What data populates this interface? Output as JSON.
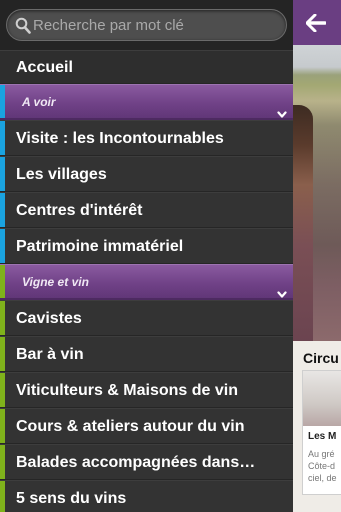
{
  "search": {
    "placeholder": "Recherche par mot clé"
  },
  "menu": {
    "home": "Accueil",
    "section_a_voir": "A voir",
    "a_voir_items": [
      "Visite : les Incontournables",
      "Les villages",
      "Centres d'intérêt",
      "Patrimoine  immatériel"
    ],
    "section_vigne": "Vigne et vin",
    "vigne_items": [
      "Cavistes",
      "Bar à vin",
      "Viticulteurs & Maisons de vin",
      "Cours & ateliers autour du vin",
      "Balades accompagnées dans…",
      "5 sens du vins"
    ]
  },
  "content": {
    "circuit_label": "Circu",
    "card_title": "Les M",
    "card_lines": [
      "Au gré",
      "Côte-d",
      "ciel, de"
    ]
  },
  "colors": {
    "accent_purple": "#6a3e82",
    "a_voir_bar": "#1aa3e0",
    "vigne_bar": "#7fb21b"
  },
  "icons": {
    "back": "back-arrow-icon",
    "search": "search-icon",
    "chevron": "chevron-down-icon"
  }
}
